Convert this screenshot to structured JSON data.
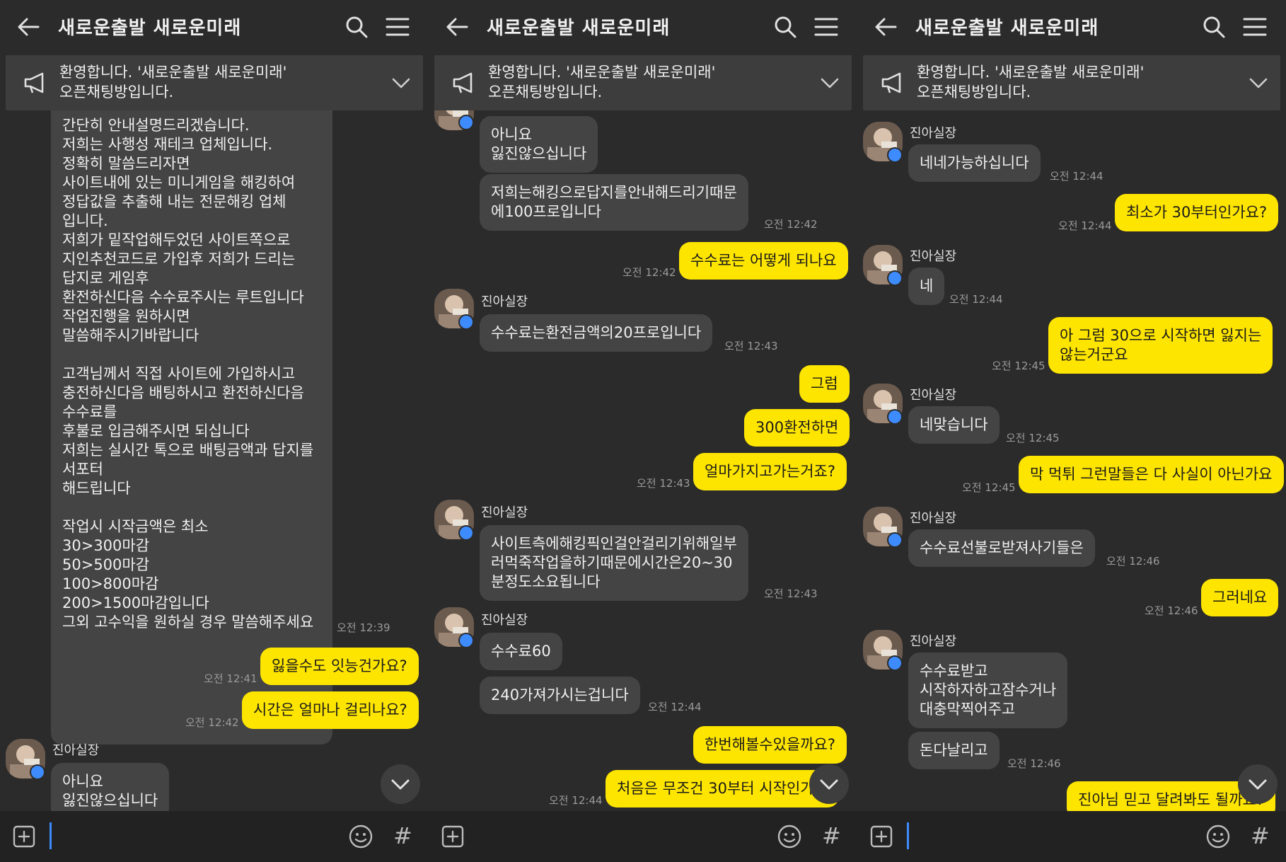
{
  "app": {
    "title": "새로운출발 새로운미래",
    "notice": "환영합니다. '새로운출발 새로운미래'\n오픈채팅방입니다.",
    "sender_name": "진아실장",
    "colors": {
      "background": "#2b2b2b",
      "incoming_bubble": "#444444",
      "outgoing_bubble": "#fee500",
      "notice_bg": "#3d3d3d",
      "accent": "#3d8bfd"
    }
  },
  "panels": [
    {
      "messages": [
        {
          "text": "간단히 안내설명드리겠습니다.\n저희는 사행성 재테크 업체입니다.\n정확히 말씀드리자면\n사이트내에 있는 미니게임을 해킹하여\n정답값을 추출해 내는 전문해킹 업체\n입니다.\n저희가 밑작업해두었던 사이트쪽으로\n지인추천코드로 가입후 저희가 드리는\n답지로 게임후\n환전하신다음 수수료주시는 루트입니다\n작업진행을 원하시면\n말씀해주시기바랍니다\n\n고객님께서 직접 사이트에 가입하시고\n충전하신다음 배팅하시고 환전하신다음\n수수료를\n후불로 입금해주시면 되십니다\n저희는 실시간 톡으로 배팅금액과 답지를\n서포터\n해드립니다\n\n작업시 시작금액은 최소\n30>300마감\n50>500마감\n100>800마감\n200>1500마감입니다\n그외 고수익을 원하실 경우 말씀해주세요",
          "time": "오전 12:39"
        },
        {
          "text": "잃을수도 잇능건가요?",
          "time": "오전 12:41"
        },
        {
          "text": "시간은 얼마나 걸리나요?",
          "time": "오전 12:42"
        },
        {
          "text": "아니요\n잃진않으십니다"
        }
      ]
    },
    {
      "messages": [
        {
          "text": "아니요\n잃진않으십니다"
        },
        {
          "text": "저희는해킹으로답지를안내해드리기때문\n에100프로입니다",
          "time": "오전 12:42"
        },
        {
          "text": "수수료는 어떻게 되나요",
          "time": "오전 12:42"
        },
        {
          "text": "수수료는환전금액의20프로입니다",
          "time": "오전 12:43"
        },
        {
          "text": "그럼"
        },
        {
          "text": "300환전하면"
        },
        {
          "text": "얼마가지고가는거죠?",
          "time": "오전 12:43"
        },
        {
          "text": "사이트측에해킹픽인걸안걸리기위해일부\n러먹죽작업을하기때문에시간은20~30\n분정도소요됩니다",
          "time": "오전 12:43"
        },
        {
          "text": "수수료60"
        },
        {
          "text": "240가져가시는겁니다",
          "time": "오전 12:44"
        },
        {
          "text": "한번해볼수있을까요?"
        },
        {
          "text": "처음은 무조건 30부터 시작인가요",
          "time": "오전 12:44"
        }
      ]
    },
    {
      "messages": [
        {
          "text": "네네가능하십니다",
          "time": "오전 12:44"
        },
        {
          "text": "최소가 30부터인가요?",
          "time": "오전 12:44"
        },
        {
          "text": "네",
          "time": "오전 12:44"
        },
        {
          "text": "아 그럼 30으로 시작하면 잃지는\n않는거군요",
          "time": "오전 12:45"
        },
        {
          "text": "네맞습니다",
          "time": "오전 12:45"
        },
        {
          "text": "막 먹튀 그런말들은 다 사실이 아닌가요",
          "time": "오전 12:45"
        },
        {
          "text": "수수료선불로받져사기들은",
          "time": "오전 12:46"
        },
        {
          "text": "그러네요",
          "time": "오전 12:46"
        },
        {
          "text": "수수료받고\n시작하자하고잠수거나\n대충막찍어주고"
        },
        {
          "text": "돈다날리고",
          "time": "오전 12:46"
        },
        {
          "text": "진아님 믿고 달려봐도 될까요?"
        }
      ]
    }
  ]
}
